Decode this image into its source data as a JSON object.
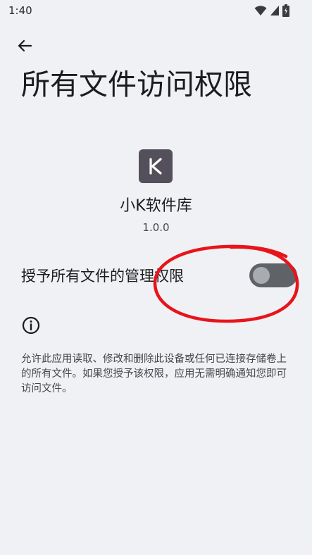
{
  "status_bar": {
    "time": "1:40",
    "icons": [
      "wifi-icon",
      "signal-icon",
      "battery-charging-icon"
    ]
  },
  "header": {
    "back_icon": "arrow-left-icon",
    "title": "所有文件访问权限"
  },
  "app": {
    "icon_letter": "K",
    "name": "小K软件库",
    "version": "1.0.0"
  },
  "permission": {
    "label": "授予所有文件的管理权限",
    "enabled": false
  },
  "info": {
    "icon": "info-icon",
    "description": "允许此应用读取、修改和删除此设备或任何已连接存储卷上的所有文件。如果您授予该权限，应用无需明确通知您即可访问文件。"
  },
  "colors": {
    "background": "#f0f1f4",
    "annotation": "#e8141b",
    "toggle_track": "#5f6368",
    "app_icon_bg": "#54505b"
  }
}
